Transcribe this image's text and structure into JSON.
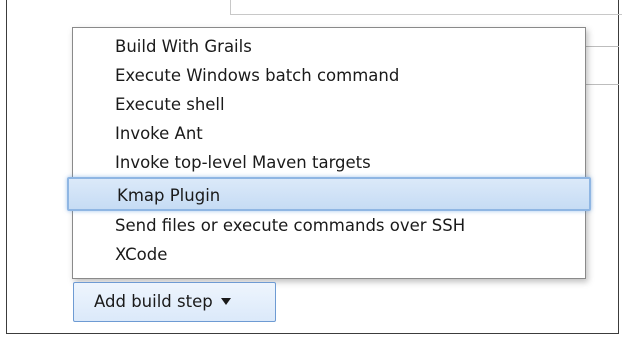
{
  "menu": {
    "items": [
      {
        "label": "Build With Grails"
      },
      {
        "label": "Execute Windows batch command"
      },
      {
        "label": "Execute shell"
      },
      {
        "label": "Invoke Ant"
      },
      {
        "label": "Invoke top-level Maven targets"
      },
      {
        "label": "Kmap Plugin"
      },
      {
        "label": "Send files or execute commands over SSH"
      },
      {
        "label": "XCode"
      }
    ],
    "selected_label": "Kmap Plugin"
  },
  "add_build_step": {
    "label": "Add build step",
    "icon": "chevron-down-icon"
  },
  "colors": {
    "highlight_fill": "#c6dcf4",
    "highlight_border": "#8fb6e3",
    "button_border": "#6e9bd3"
  }
}
